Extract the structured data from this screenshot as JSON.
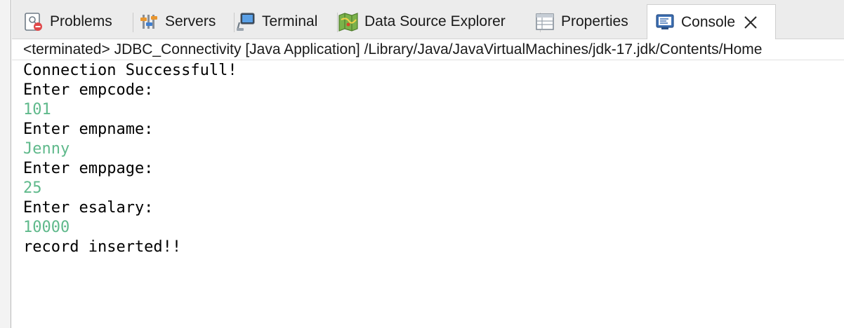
{
  "tabs": [
    {
      "label": "Problems",
      "icon": "problems-icon",
      "active": false
    },
    {
      "label": "Servers",
      "icon": "servers-icon",
      "active": false
    },
    {
      "label": "Terminal",
      "icon": "terminal-icon",
      "active": false
    },
    {
      "label": "Data Source Explorer",
      "icon": "data-source-explorer-icon",
      "active": false
    },
    {
      "label": "Properties",
      "icon": "properties-icon",
      "active": false
    },
    {
      "label": "Console",
      "icon": "console-icon",
      "active": true
    }
  ],
  "status": "<terminated> JDBC_Connectivity [Java Application] /Library/Java/JavaVirtualMachines/jdk-17.jdk/Contents/Home",
  "console_lines": [
    {
      "text": "Connection Successfull!",
      "kind": "output"
    },
    {
      "text": "Enter empcode:",
      "kind": "output"
    },
    {
      "text": "101",
      "kind": "input"
    },
    {
      "text": "Enter empname:",
      "kind": "output"
    },
    {
      "text": "Jenny",
      "kind": "input"
    },
    {
      "text": "Enter emppage:",
      "kind": "output"
    },
    {
      "text": "25",
      "kind": "input"
    },
    {
      "text": "Enter esalary:",
      "kind": "output"
    },
    {
      "text": "10000",
      "kind": "input"
    },
    {
      "text": "record inserted!!",
      "kind": "output"
    }
  ],
  "colors": {
    "input_text": "#5fb98b",
    "output_text": "#000000",
    "tabbar_bg": "#ececec"
  }
}
